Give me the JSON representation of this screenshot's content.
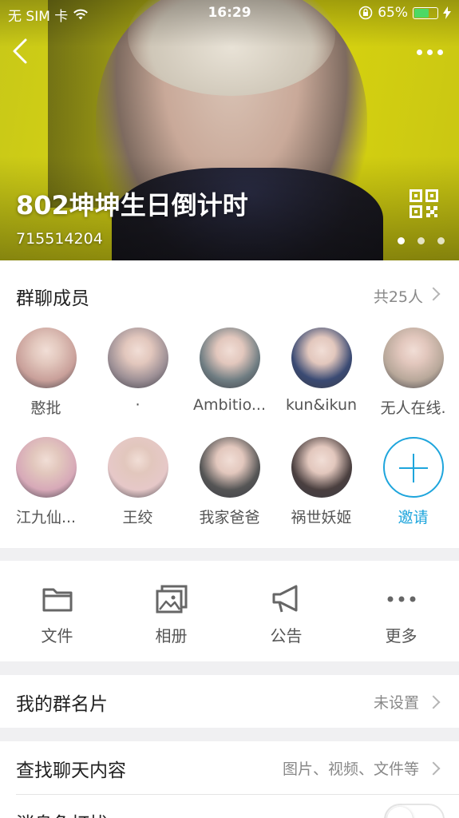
{
  "status_bar": {
    "carrier": "无 SIM 卡",
    "time": "16:29",
    "battery_percent": "65%",
    "battery_level": 0.65,
    "icons": [
      "wifi-icon",
      "orientation-lock-icon",
      "battery-icon",
      "charging-icon"
    ]
  },
  "header": {
    "group_name": "802坤坤生日倒计时",
    "group_id": "715514204",
    "carousel_pages": 3,
    "carousel_active": 0
  },
  "members": {
    "title": "群聊成员",
    "count_label": "共25人",
    "list": [
      {
        "name": "憨批",
        "color": "#c9a09a"
      },
      {
        "name": "·",
        "color": "#9c8f95"
      },
      {
        "name": "Ambitio...",
        "color": "#6f7d82"
      },
      {
        "name": "kun&ikun",
        "color": "#3a4a73"
      },
      {
        "name": "无人在线.",
        "color": "#b8a89a"
      },
      {
        "name": "江九仙...",
        "color": "#d7a9b8"
      },
      {
        "name": "王绞",
        "color": "#e6c8c8"
      },
      {
        "name": "我家爸爸",
        "color": "#555555"
      },
      {
        "name": "祸世妖姬",
        "color": "#4a3f3f"
      }
    ],
    "invite_label": "邀请"
  },
  "tools": [
    {
      "label": "文件",
      "icon": "folder-icon"
    },
    {
      "label": "相册",
      "icon": "photo-album-icon"
    },
    {
      "label": "公告",
      "icon": "megaphone-icon"
    },
    {
      "label": "更多",
      "icon": "more-icon"
    }
  ],
  "my_card": {
    "label": "我的群名片",
    "value": "未设置"
  },
  "search_chat": {
    "label": "查找聊天内容",
    "value": "图片、视频、文件等"
  },
  "mute": {
    "label": "消息免打扰"
  },
  "colors": {
    "accent": "#1ea5dc",
    "banner": "#d4d214",
    "battery": "#4cd964"
  }
}
